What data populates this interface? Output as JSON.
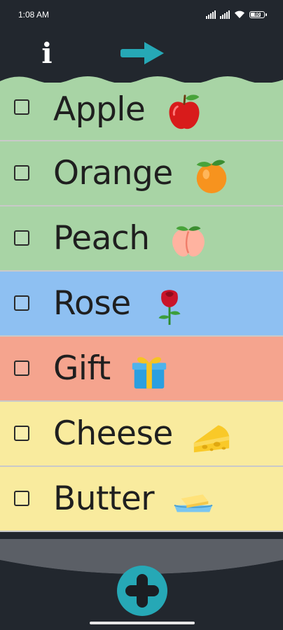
{
  "status_bar": {
    "time": "1:08 AM",
    "battery": "80"
  },
  "toolbar": {
    "info_label": "i",
    "info_icon": "info-icon",
    "next_icon": "arrow-right-icon",
    "accent": "#26a8b6"
  },
  "items": [
    {
      "label": "Apple",
      "emoji": "apple-emoji",
      "color": "#a8d4a5",
      "checked": false
    },
    {
      "label": "Orange",
      "emoji": "orange-emoji",
      "color": "#a8d4a5",
      "checked": false
    },
    {
      "label": "Peach",
      "emoji": "peach-emoji",
      "color": "#a8d4a5",
      "checked": false
    },
    {
      "label": "Rose",
      "emoji": "rose-emoji",
      "color": "#8ec0f2",
      "checked": false
    },
    {
      "label": "Gift",
      "emoji": "gift-emoji",
      "color": "#f5a48e",
      "checked": false
    },
    {
      "label": "Cheese",
      "emoji": "cheese-emoji",
      "color": "#f9eb9e",
      "checked": false
    },
    {
      "label": "Butter",
      "emoji": "butter-emoji",
      "color": "#f9eb9e",
      "checked": false
    }
  ],
  "fab": {
    "icon": "plus-icon",
    "color": "#26a8b6"
  }
}
